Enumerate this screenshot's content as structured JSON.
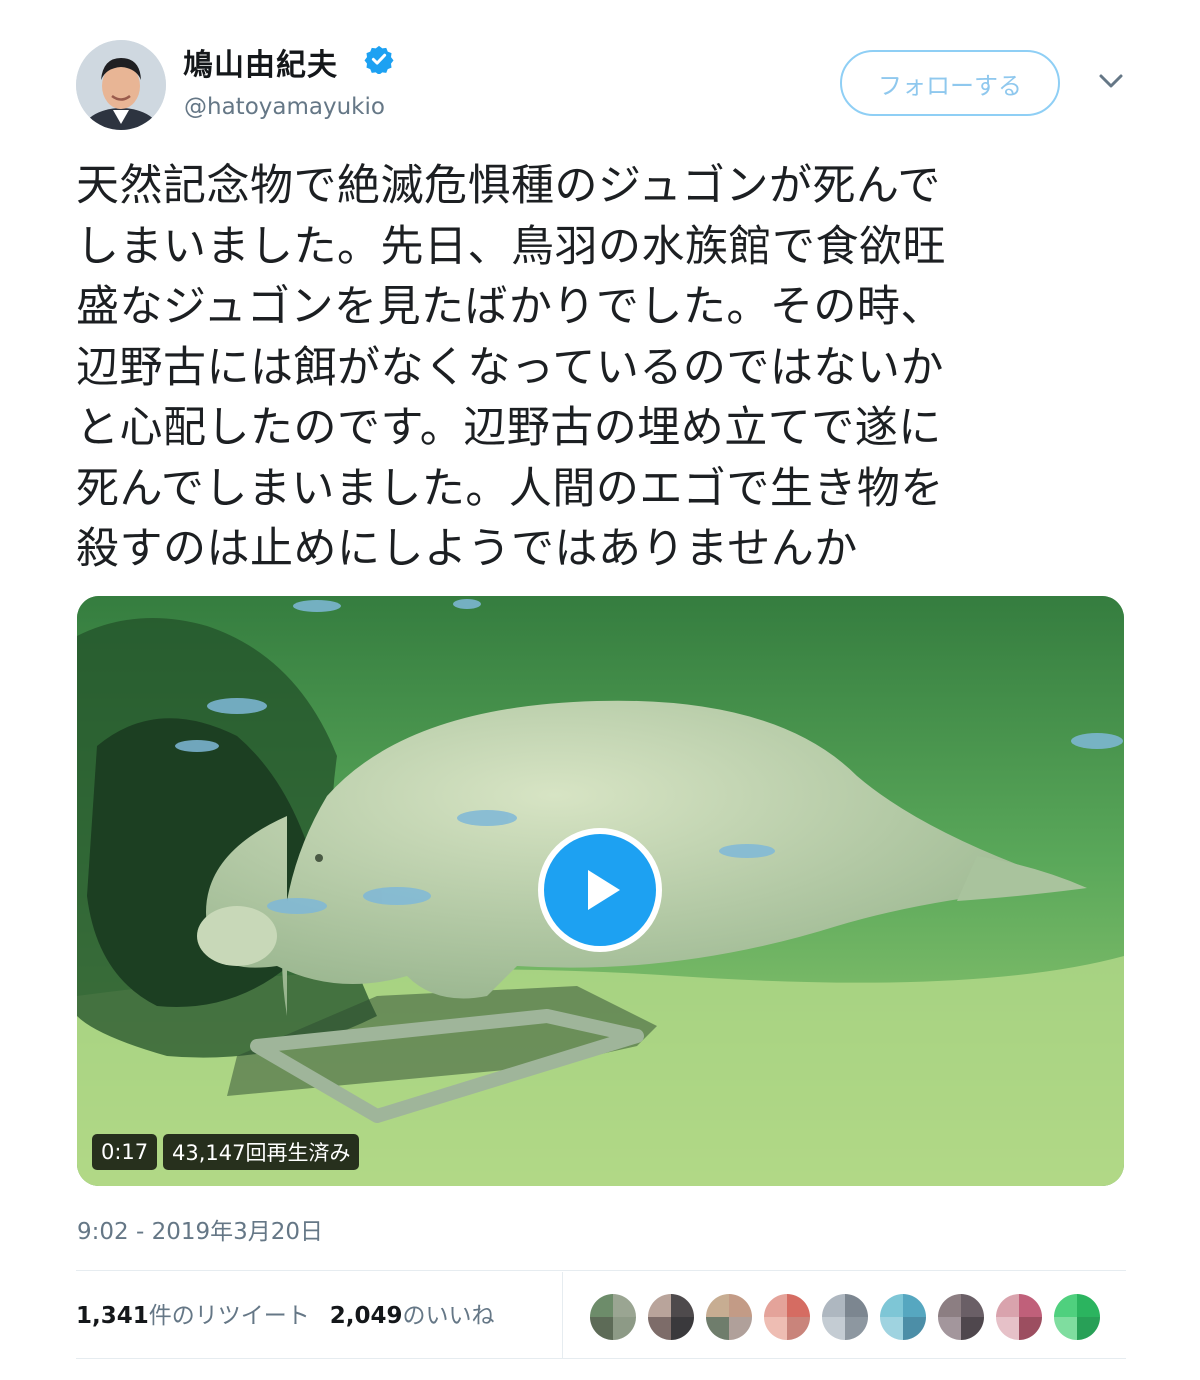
{
  "user": {
    "display_name": "鳩山由紀夫",
    "handle": "@hatoyamayukio",
    "verified_icon": "verified-badge-icon",
    "follow_label": "フォローする"
  },
  "tweet": {
    "text": "天然記念物で絶滅危惧種のジュゴンが死んで\nしまいました。先日、鳥羽の水族館で食欲旺\n盛なジュゴンを見たばかりでした。その時、\n辺野古には餌がなくなっているのではないか\nと心配したのです。辺野古の埋め立てで遂に\n死んでしまいました。人間のエゴで生き物を\n殺すのは止めにしようではありませんか",
    "timestamp": "9:02 - 2019年3月20日"
  },
  "video": {
    "duration": "0:17",
    "views": "43,147回再生済み",
    "play_icon": "play-icon"
  },
  "stats": {
    "retweets_count": "1,341",
    "retweets_label": "件のリツイート",
    "likes_count": "2,049",
    "likes_label": "のいいね"
  },
  "likers": [
    {
      "colors": [
        "#6d8c6a",
        "#9aa592",
        "#5d6b57",
        "#8d9a86"
      ]
    },
    {
      "colors": [
        "#b9a49b",
        "#4e4a4c",
        "#7d6c69",
        "#3a393c"
      ]
    },
    {
      "colors": [
        "#c7ad92",
        "#c39b86",
        "#6f7d6c",
        "#b0a09a"
      ]
    },
    {
      "colors": [
        "#e4a39a",
        "#d56c62",
        "#eebdb3",
        "#c9847b"
      ]
    },
    {
      "colors": [
        "#aeb7c0",
        "#7c8690",
        "#c4ccd3",
        "#8d97a0"
      ]
    },
    {
      "colors": [
        "#7ec6d6",
        "#56a7c0",
        "#9fd3e0",
        "#4c8ea7"
      ]
    },
    {
      "colors": [
        "#8c7e82",
        "#6a5f66",
        "#a3969c",
        "#4f474d"
      ]
    },
    {
      "colors": [
        "#d9a3ad",
        "#c0607a",
        "#e6c1c8",
        "#9c4e60"
      ]
    },
    {
      "colors": [
        "#4fd07e",
        "#2bb45f",
        "#7fdd9f",
        "#28a057"
      ]
    }
  ]
}
